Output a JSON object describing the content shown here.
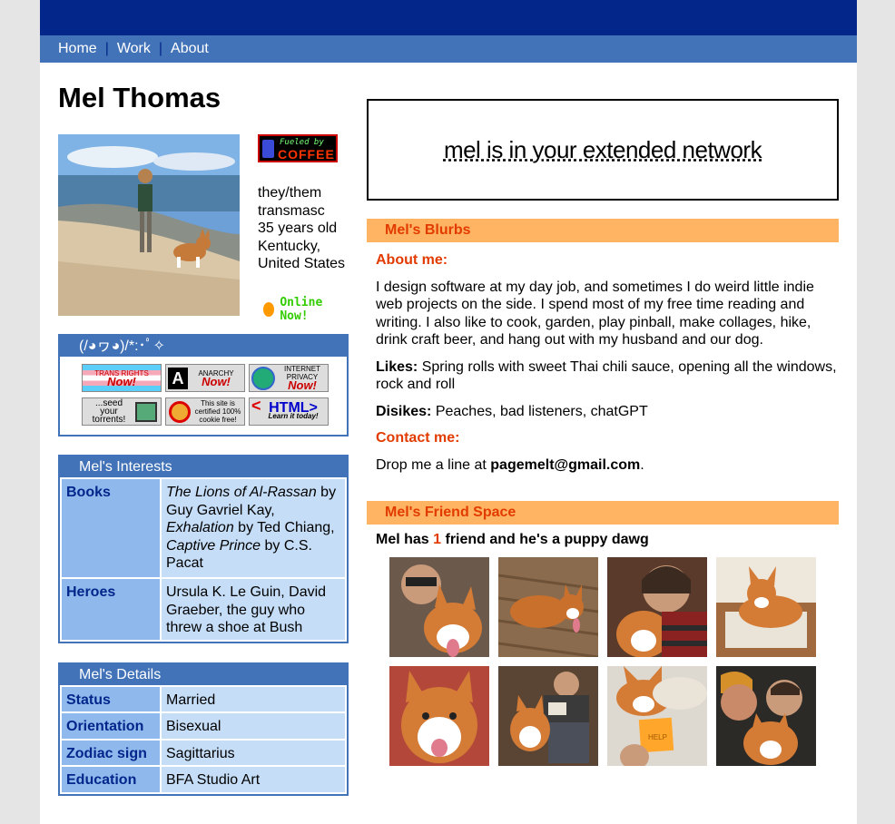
{
  "nav": {
    "home": "Home",
    "work": "Work",
    "about": "About",
    "sep": "|"
  },
  "profile": {
    "name": "Mel Thomas",
    "pronouns": "they/them",
    "gender": "transmasc",
    "age": "35 years old",
    "location": "Kentucky, United States",
    "online": "Online Now!",
    "coffee_line1": "Fueled by",
    "coffee_line2": "COFFEE"
  },
  "badges": {
    "header": "(/◕ヮ◕)/*:･ﾟ✧",
    "items": [
      {
        "top": "TRANS RIGHTS",
        "main": "Now!"
      },
      {
        "top": "ANARCHY",
        "main": "Now!"
      },
      {
        "top": "INTERNET PRIVACY",
        "main": "Now!"
      },
      {
        "top": "...seed your torrents!",
        "main": ""
      },
      {
        "top": "This site is certified 100% cookie free!",
        "main": ""
      },
      {
        "top": "HTML>",
        "main": "Learn it today!"
      }
    ]
  },
  "interests": {
    "header": "Mel's Interests",
    "books_label": "Books",
    "books": [
      {
        "title": "The Lions of Al-Rassan",
        "by": " by Guy Gavriel Kay, "
      },
      {
        "title": "Exhalation",
        "by": " by Ted Chiang, "
      },
      {
        "title": "Captive Prince",
        "by": " by C.S. Pacat"
      }
    ],
    "heroes_label": "Heroes",
    "heroes": "Ursula K. Le Guin, David Graeber, the guy who threw a shoe at Bush"
  },
  "details": {
    "header": "Mel's Details",
    "rows": [
      {
        "k": "Status",
        "v": "Married"
      },
      {
        "k": "Orientation",
        "v": "Bisexual"
      },
      {
        "k": "Zodiac sign",
        "v": "Sagittarius"
      },
      {
        "k": "Education",
        "v": "BFA Studio Art"
      }
    ]
  },
  "network": "mel is in your extended network",
  "blurbs": {
    "header": "Mel's Blurbs",
    "about_label": "About me:",
    "about_text": "I design software at my day job, and sometimes I do weird little indie web projects on the side. I spend most of my free time reading and writing. I also like to cook, garden, play pinball, make collages, hike, drink craft beer, and hang out with my husband and our dog.",
    "likes_label": "Likes:",
    "likes_text": " Spring rolls with sweet Thai chili sauce, opening all the windows, rock and roll",
    "dislikes_label": "Disikes:",
    "dislikes_text": " Peaches, bad listeners, chatGPT",
    "contact_label": "Contact me:",
    "contact_pre": "Drop me a line at ",
    "contact_email": "pagemelt@gmail.com",
    "contact_post": "."
  },
  "friends": {
    "header": "Mel's Friend Space",
    "count_pre": "Mel has ",
    "count": "1",
    "count_post": " friend and he's a puppy dawg",
    "photos": [
      "selfie-with-corgi",
      "corgi-on-deck",
      "person-with-corgi",
      "corgi-on-chair",
      "corgi-smiling",
      "person-reading-with-corgi",
      "corgi-with-help-note",
      "couple-kissing-with-corgi"
    ],
    "help_note": "HELP"
  }
}
